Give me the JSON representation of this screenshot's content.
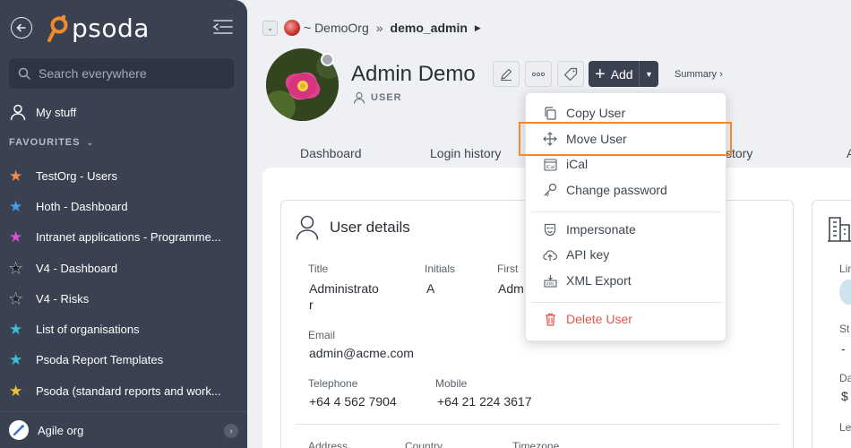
{
  "sidebar": {
    "logo_text": "psoda",
    "search_placeholder": "Search everywhere",
    "my_stuff": "My stuff",
    "favourites_heading": "FAVOURITES",
    "favourites": [
      {
        "label": "TestOrg - Users",
        "color": "#f08a4b"
      },
      {
        "label": "Hoth - Dashboard",
        "color": "#4a9be8"
      },
      {
        "label": "Intranet applications - Programme...",
        "color": "#d84fd1"
      },
      {
        "label": "V4 - Dashboard",
        "color": "#1e2228"
      },
      {
        "label": "V4 - Risks",
        "color": "#1e2228"
      },
      {
        "label": "List of organisations",
        "color": "#3bbfd6"
      },
      {
        "label": "Psoda Report Templates",
        "color": "#3bbfd6"
      },
      {
        "label": "Psoda (standard reports and work...",
        "color": "#f2c233"
      }
    ],
    "org_switcher": "Agile org"
  },
  "header": {
    "breadcrumb_org": "~ DemoOrg",
    "breadcrumb_separator": "»",
    "breadcrumb_user": "demo_admin",
    "user_name": "Admin Demo",
    "user_role": "USER",
    "add_label": "Add",
    "summary_label": "Summary ›"
  },
  "tabs": [
    "Dashboard",
    "Login history",
    "story",
    "A"
  ],
  "menu": {
    "items": [
      {
        "label": "Copy User",
        "icon": "copy-icon"
      },
      {
        "label": "Move User",
        "icon": "move-icon"
      },
      {
        "label": "iCal",
        "icon": "ical-icon"
      },
      {
        "label": "Change password",
        "icon": "key-icon"
      },
      {
        "label": "Impersonate",
        "icon": "mask-icon"
      },
      {
        "label": "API key",
        "icon": "cloud-icon"
      },
      {
        "label": "XML Export",
        "icon": "xml-export-icon"
      },
      {
        "label": "Delete User",
        "icon": "trash-icon"
      }
    ]
  },
  "user_details": {
    "title": "User details",
    "fields": {
      "title_label": "Title",
      "title_value_line1": "Administrato",
      "title_value_line2": "r",
      "initials_label": "Initials",
      "initials_value": "A",
      "first_label": "First",
      "first_value": "Adm",
      "email_label": "Email",
      "email_value": "admin@acme.com",
      "telephone_label": "Telephone",
      "telephone_value": "+64 4 562 7904",
      "mobile_label": "Mobile",
      "mobile_value": "+64 21 224 3617",
      "address_label": "Address",
      "country_label": "Country",
      "timezone_label": "Timezone"
    }
  },
  "side_card": {
    "labels": [
      "Lin",
      "St",
      "-",
      "Da",
      "$",
      "Le"
    ]
  },
  "colors": {
    "sidebar_bg": "#3a4150",
    "highlight": "#f0882f",
    "danger": "#e0574f"
  }
}
